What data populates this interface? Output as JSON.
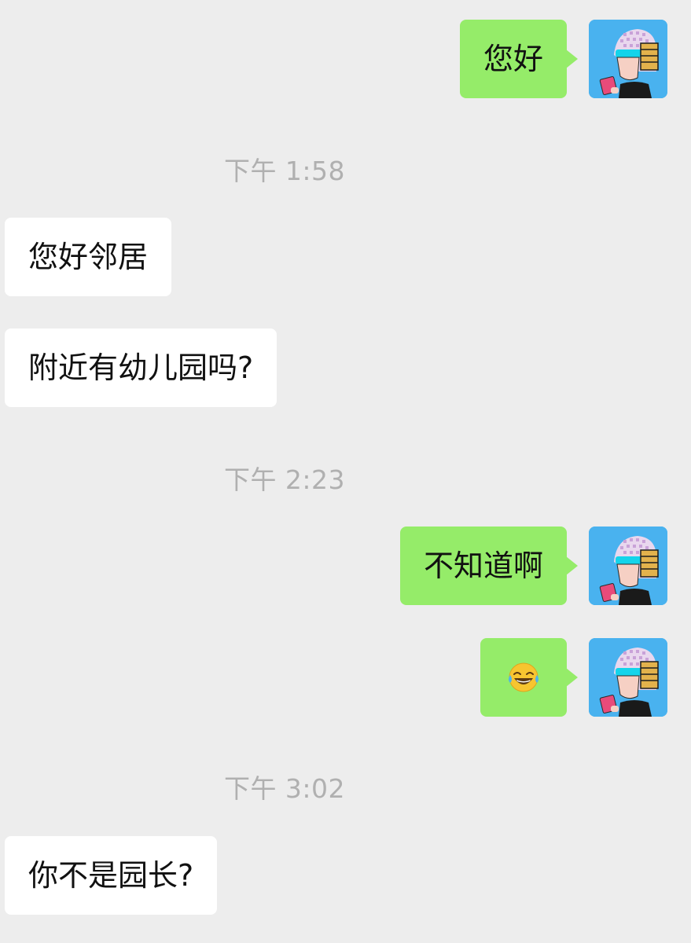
{
  "messages": [
    {
      "type": "outgoing",
      "text": "您好"
    },
    {
      "type": "time",
      "text": "下午 1:58"
    },
    {
      "type": "incoming",
      "text": "您好邻居"
    },
    {
      "type": "incoming",
      "text": "附近有幼儿园吗?"
    },
    {
      "type": "time",
      "text": "下午 2:23"
    },
    {
      "type": "outgoing",
      "text": "不知道啊"
    },
    {
      "type": "outgoing",
      "emoji": "face-with-tears-of-joy-icon",
      "text": ""
    },
    {
      "type": "time",
      "text": "下午 3:02"
    },
    {
      "type": "incoming",
      "text": "你不是园长?"
    }
  ],
  "colors": {
    "background": "#ededed",
    "incoming_bubble": "#ffffff",
    "outgoing_bubble": "#95ec69",
    "timestamp": "#b0b0b0",
    "avatar_background": "#49b2ef"
  },
  "avatar": {
    "icon": "cartoon-robot-helmet-avatar-icon"
  }
}
